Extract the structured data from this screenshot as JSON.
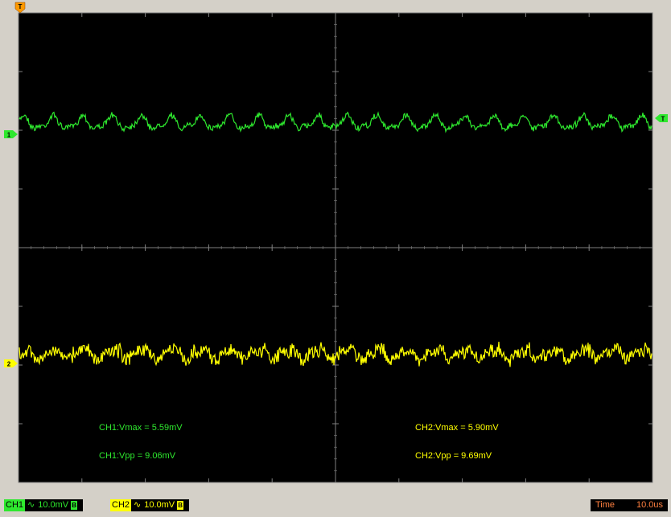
{
  "colors": {
    "ch1": "#2ee82e",
    "ch2": "#ffff00",
    "grid": "#808080",
    "trigger": "#ff9900",
    "time_text": "#ff8040"
  },
  "markers": {
    "trigger_top": "T",
    "ch1": "1",
    "ch2": "2",
    "trigger_level": "T"
  },
  "measurements": {
    "ch1_vmax": "CH1:Vmax = 5.59mV",
    "ch1_vpp": "CH1:Vpp = 9.06mV",
    "ch2_vmax": "CH2:Vmax = 5.90mV",
    "ch2_vpp": "CH2:Vpp = 9.69mV"
  },
  "status_bar": {
    "ch1_name": "CH1",
    "ch1_coupling": "∿",
    "ch1_scale": "10.0mV",
    "ch1_bw": "B",
    "ch2_name": "CH2",
    "ch2_coupling": "∿",
    "ch2_scale": "10.0mV",
    "ch2_bw": "B",
    "time_label": "Time",
    "time_value": "10.0us"
  }
}
